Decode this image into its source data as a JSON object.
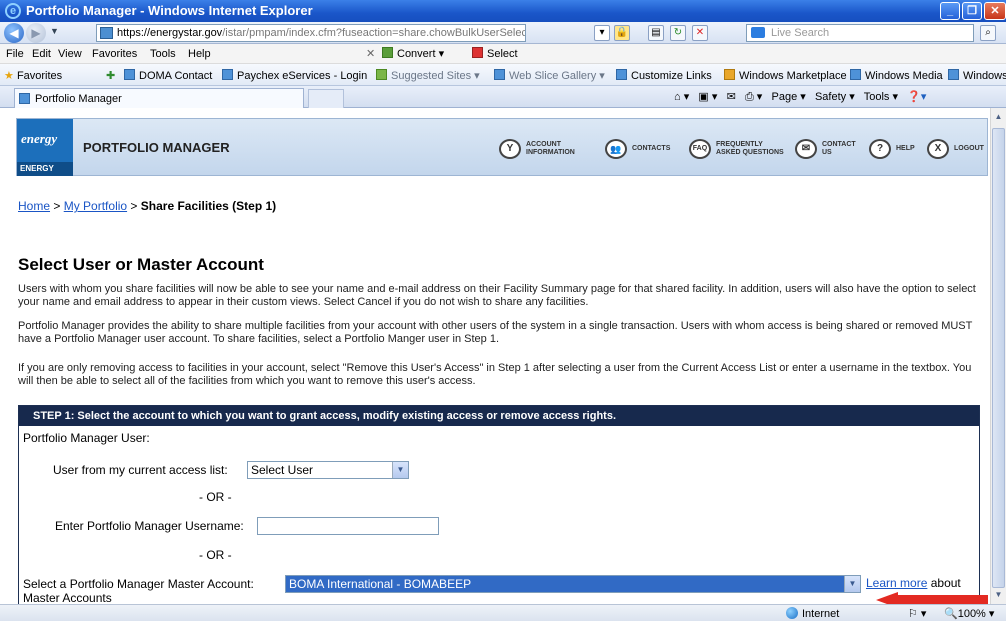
{
  "window": {
    "title": "Portfolio Manager - Windows Internet Explorer"
  },
  "address_bar": {
    "url_prefix": "https://",
    "url_domain": "energystar.gov",
    "url_path": "/istar/pmpam/index.cfm?fuseaction=share.chowBulkUserSelect",
    "search_placeholder": "Live Search"
  },
  "menu": {
    "items": [
      "File",
      "Edit",
      "View",
      "Favorites",
      "Tools",
      "Help"
    ],
    "convert": "Convert",
    "select": "Select"
  },
  "favorites_bar": {
    "favorites_label": "Favorites",
    "links": [
      "DOMA Contact",
      "Paychex eServices - Login",
      "Suggested Sites",
      "Web Slice Gallery",
      "Customize Links",
      "Windows Marketplace",
      "Windows Media",
      "Windows"
    ]
  },
  "tab": {
    "label": "Portfolio Manager"
  },
  "tab_tools": {
    "page": "Page",
    "safety": "Safety",
    "tools": "Tools"
  },
  "header": {
    "logo_text": "energy",
    "logo_bottom": "ENERGY STAR",
    "title": "PORTFOLIO MANAGER",
    "nav": [
      {
        "icon": "Y",
        "label1": "ACCOUNT",
        "label2": "INFORMATION"
      },
      {
        "icon": "👥",
        "label1": "CONTACTS",
        "label2": ""
      },
      {
        "icon": "FAQ",
        "label1": "FREQUENTLY",
        "label2": "ASKED QUESTIONS"
      },
      {
        "icon": "✉",
        "label1": "CONTACT",
        "label2": "US"
      },
      {
        "icon": "?",
        "label1": "HELP",
        "label2": ""
      },
      {
        "icon": "X",
        "label1": "LOGOUT",
        "label2": ""
      }
    ]
  },
  "breadcrumb": {
    "home": "Home",
    "sep": ">",
    "my_portfolio": "My Portfolio",
    "current": "Share Facilities (Step 1)"
  },
  "main": {
    "heading": "Select User or Master Account",
    "para1": "Users with whom you share facilities will now be able to see your name and e-mail address on their Facility Summary page for that shared facility. In addition, users will also have the option to select your name and email address to appear in their custom views. Select Cancel if you do not wish to share any facilities.",
    "para2": "Portfolio Manager provides the ability to share multiple facilities from your account with other users of the system in a single transaction. Users with whom access is being shared or removed MUST have a Portfolio Manager user account. To share facilities, select a Portfolio Manger user in Step 1.",
    "para3": "If you are only removing access to facilities in your account, select \"Remove this User's Access\" in Step 1 after selecting a user from the Current Access List or enter a username in the textbox. You will then be able to select all of the facilities from which you want to remove this user's access."
  },
  "step1": {
    "header": "STEP 1: Select the account to which you want to grant access, modify existing access or remove access rights.",
    "pm_user_label": "Portfolio Manager User:",
    "access_list_label": "User from my current access list:",
    "access_list_value": "Select User",
    "or1": "- OR -",
    "username_label": "Enter Portfolio Manager Username:",
    "username_value": "",
    "or2": "- OR -",
    "master_label": "Select a Portfolio Manager Master Account:",
    "master_value": "BOMA International - BOMABEEP",
    "learn_more": "Learn more",
    "about": "about",
    "master_accounts": "Master Accounts"
  },
  "status": {
    "zone": "Internet",
    "zoom": "100%"
  }
}
